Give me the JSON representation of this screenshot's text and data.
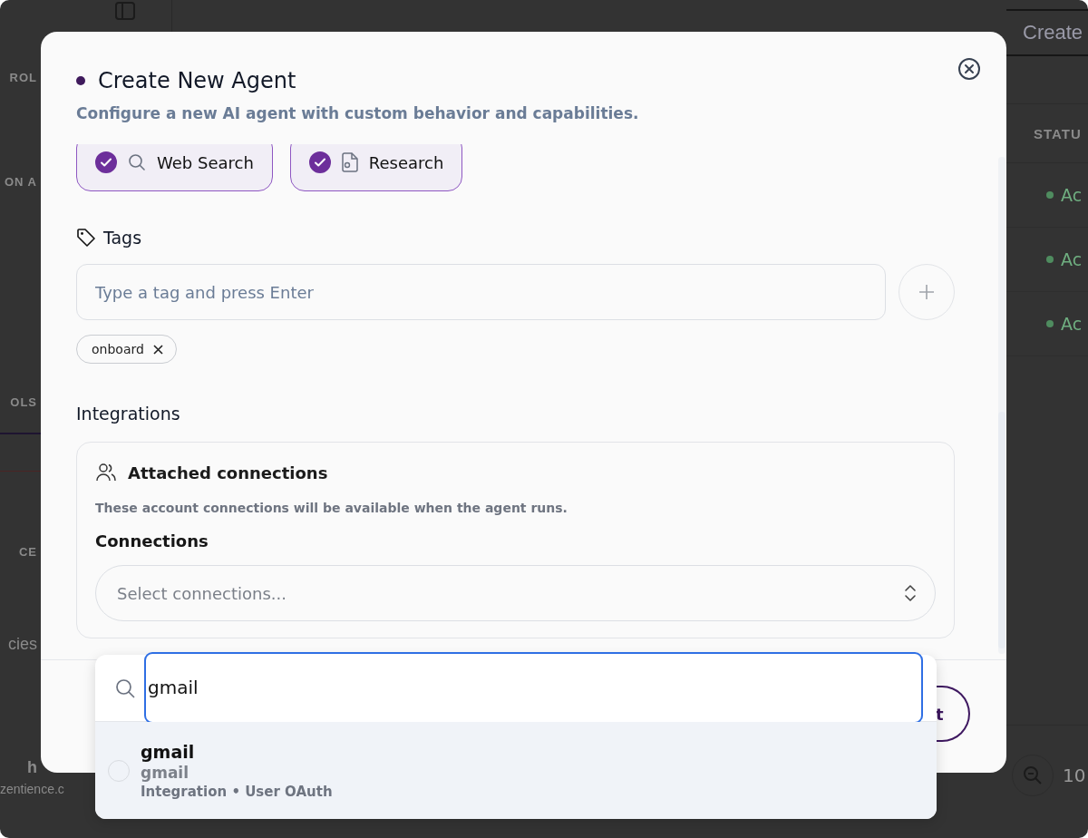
{
  "background": {
    "sidebar_fragments": [
      "ROL",
      "ON A",
      "OLS",
      "CE",
      "cies",
      "h",
      "zentience.c"
    ],
    "create_button": "Create",
    "table_header": "STATU",
    "status_rows": [
      {
        "label": "Ac"
      },
      {
        "label": "Ac"
      },
      {
        "label": "Ac"
      }
    ],
    "zoom_level": "10"
  },
  "dialog": {
    "title": "Create New Agent",
    "subtitle": "Configure a new AI agent with custom behavior and capabilities.",
    "capabilities": [
      {
        "label": "Web Search",
        "checked": true,
        "kind": "search"
      },
      {
        "label": "Research",
        "checked": true,
        "kind": "document"
      }
    ],
    "tags": {
      "label": "Tags",
      "placeholder": "Type a tag and press Enter",
      "items": [
        "onboard"
      ]
    },
    "integrations": {
      "heading": "Integrations",
      "card_title": "Attached connections",
      "description": "These account connections will be available when the agent runs.",
      "field_label": "Connections",
      "placeholder": "Select connections..."
    },
    "footer_button": "t"
  },
  "dropdown": {
    "search_value": "gmail",
    "options": [
      {
        "title": "gmail",
        "subtitle": "gmail",
        "meta": "Integration • User OAuth",
        "selected": false
      }
    ]
  }
}
